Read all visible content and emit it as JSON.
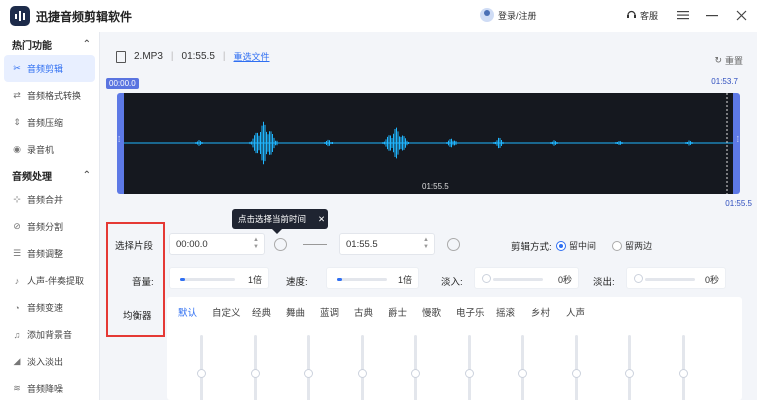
{
  "app": {
    "title": "迅捷音频剪辑软件",
    "login": "登录/注册",
    "support": "客服"
  },
  "window": {
    "menu_icon": "menu-icon",
    "minimize_icon": "minimize-icon",
    "close_icon": "close-icon"
  },
  "sidebar": {
    "sections": [
      {
        "title": "热门功能",
        "items": [
          {
            "label": "音频剪辑",
            "icon": "scissors-icon",
            "active": true
          },
          {
            "label": "音频格式转换",
            "icon": "convert-icon"
          },
          {
            "label": "音频压缩",
            "icon": "compress-icon"
          },
          {
            "label": "录音机",
            "icon": "recorder-icon"
          }
        ]
      },
      {
        "title": "音频处理",
        "items": [
          {
            "label": "音频合并",
            "icon": "merge-icon"
          },
          {
            "label": "音频分割",
            "icon": "split-icon"
          },
          {
            "label": "音频调整",
            "icon": "adjust-icon"
          },
          {
            "label": "人声-伴奏提取",
            "icon": "voice-icon"
          },
          {
            "label": "音频变速",
            "icon": "speed-icon"
          },
          {
            "label": "添加背景音",
            "icon": "bgm-icon"
          },
          {
            "label": "淡入淡出",
            "icon": "fade-icon"
          },
          {
            "label": "音频降噪",
            "icon": "denoise-icon"
          }
        ]
      }
    ]
  },
  "file": {
    "name": "2.MP3",
    "duration": "01:55.5",
    "change_label": "重选文件",
    "reset_label": "重置"
  },
  "waveform": {
    "start_time": "00:00.0",
    "end_time_top": "01:53.7",
    "cursor_time": "01:55.5",
    "end_time_bottom": "01:55.5"
  },
  "tooltip": {
    "text": "点击选择当前时间",
    "close": "✕"
  },
  "controls": {
    "segment_label": "选择片段",
    "start_value": "00:00.0",
    "end_value": "01:55.5",
    "cut_mode_label": "剪辑方式:",
    "mode_keep_middle": "留中间",
    "mode_keep_sides": "留两边",
    "volume_label": "音量:",
    "volume_value": "1倍",
    "speed_label": "速度:",
    "speed_value": "1倍",
    "fade_in_label": "淡入:",
    "fade_in_value": "0秒",
    "fade_out_label": "淡出:",
    "fade_out_value": "0秒",
    "eq_label": "均衡器"
  },
  "eq": {
    "presets": [
      "默认",
      "自定义",
      "经典",
      "舞曲",
      "蓝调",
      "古典",
      "爵士",
      "慢歌",
      "电子乐",
      "摇滚",
      "乡村",
      "人声"
    ],
    "active": 0,
    "bands": 10
  },
  "colors": {
    "accent": "#2f6ff2",
    "wave": "#1fb6ff",
    "highlight": "#e53935"
  }
}
